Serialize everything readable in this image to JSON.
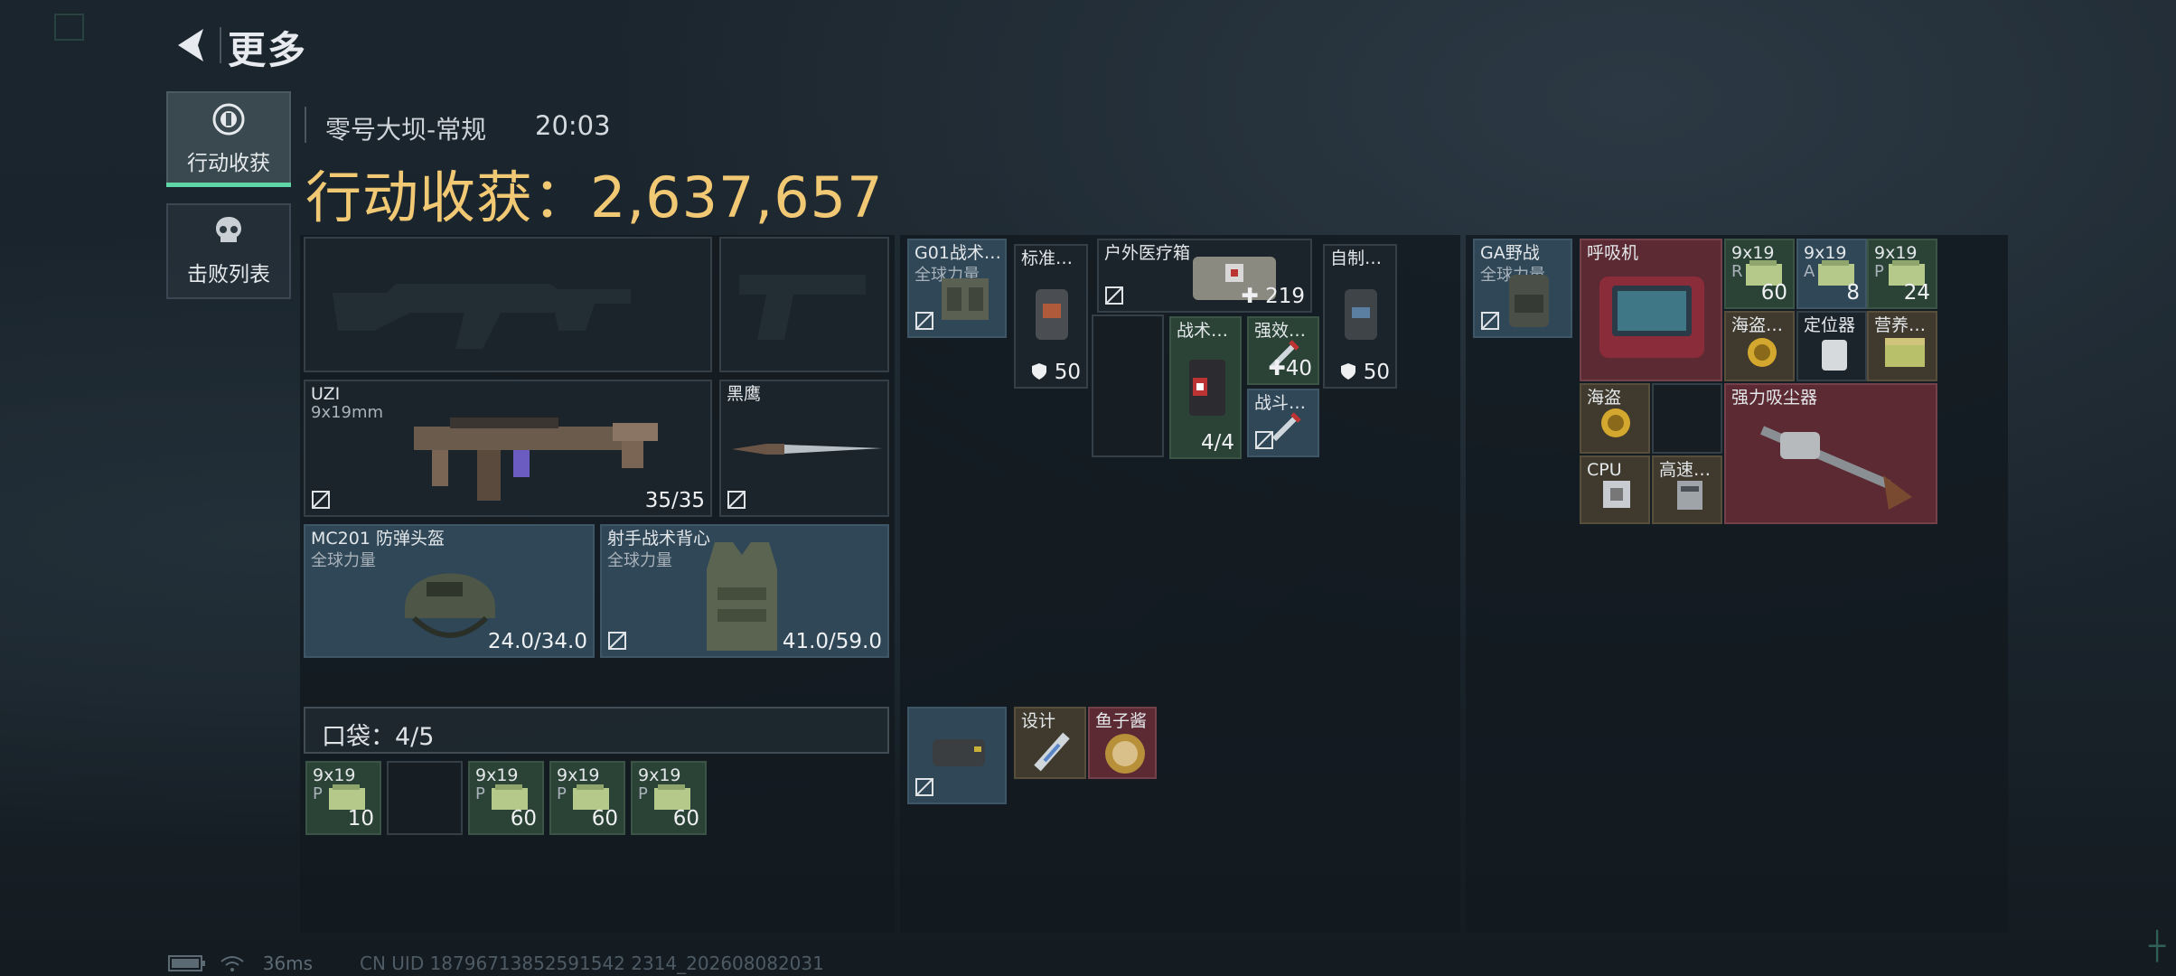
{
  "header": {
    "title": "更多"
  },
  "sidebar": {
    "tab_loot": "行动收获",
    "tab_kills": "击败列表"
  },
  "match": {
    "map": "零号大坝-常规",
    "time": "20:03"
  },
  "summary": {
    "label_value": "行动收获：2,637,657"
  },
  "equipment": {
    "primary_weapon": {
      "name": "UZI",
      "ammo_type": "9x19mm",
      "ammo": "35/35"
    },
    "melee": {
      "name": "黑鹰"
    },
    "helmet": {
      "name": "MC201 防弹头盔",
      "brand": "全球力量",
      "durability": "24.0/34.0"
    },
    "armor": {
      "name": "射手战术背心",
      "brand": "全球力量",
      "durability": "41.0/59.0"
    }
  },
  "pocket": {
    "label": "口袋：",
    "count": "4/5",
    "items": [
      {
        "name": "9x19",
        "sub": "P",
        "count": "10"
      },
      {
        "name": "9x19",
        "sub": "P",
        "count": "60"
      },
      {
        "name": "9x19",
        "sub": "P",
        "count": "60"
      },
      {
        "name": "9x19",
        "sub": "P",
        "count": "60"
      }
    ]
  },
  "chest_rig": {
    "name": "G01战术…",
    "brand": "全球力量",
    "items": [
      {
        "name": "标准…",
        "value": "50"
      },
      {
        "name": "户外医疗箱",
        "value": "219"
      },
      {
        "name": "自制…",
        "value": "50"
      },
      {
        "name": "战术…",
        "value": "4/4"
      },
      {
        "name": "强效…",
        "value": "40"
      },
      {
        "name": "战斗…"
      }
    ]
  },
  "backpack_small": {
    "items": [
      {
        "name": "设计"
      },
      {
        "name": "鱼子酱"
      }
    ]
  },
  "backpack": {
    "name": "GA野战",
    "brand": "全球力量",
    "items": [
      {
        "name": "呼吸机"
      },
      {
        "name": "9x19",
        "sub": "R",
        "count": "60"
      },
      {
        "name": "9x19",
        "sub": "A",
        "count": "8"
      },
      {
        "name": "9x19",
        "sub": "P",
        "count": "24"
      },
      {
        "name": "海盗…"
      },
      {
        "name": "定位器"
      },
      {
        "name": "营养…"
      },
      {
        "name": "海盗"
      },
      {
        "name": "强力吸尘器"
      },
      {
        "name": "CPU"
      },
      {
        "name": "高速…"
      }
    ]
  },
  "footer": {
    "ping": "36ms",
    "uid": "CN UID 18796713852591542 2314_202608082031"
  },
  "colors": {
    "accent": "#5fd6a5",
    "gold": "#f1c873",
    "red_item": "#5b2a33",
    "blue_item": "#2f4757"
  }
}
